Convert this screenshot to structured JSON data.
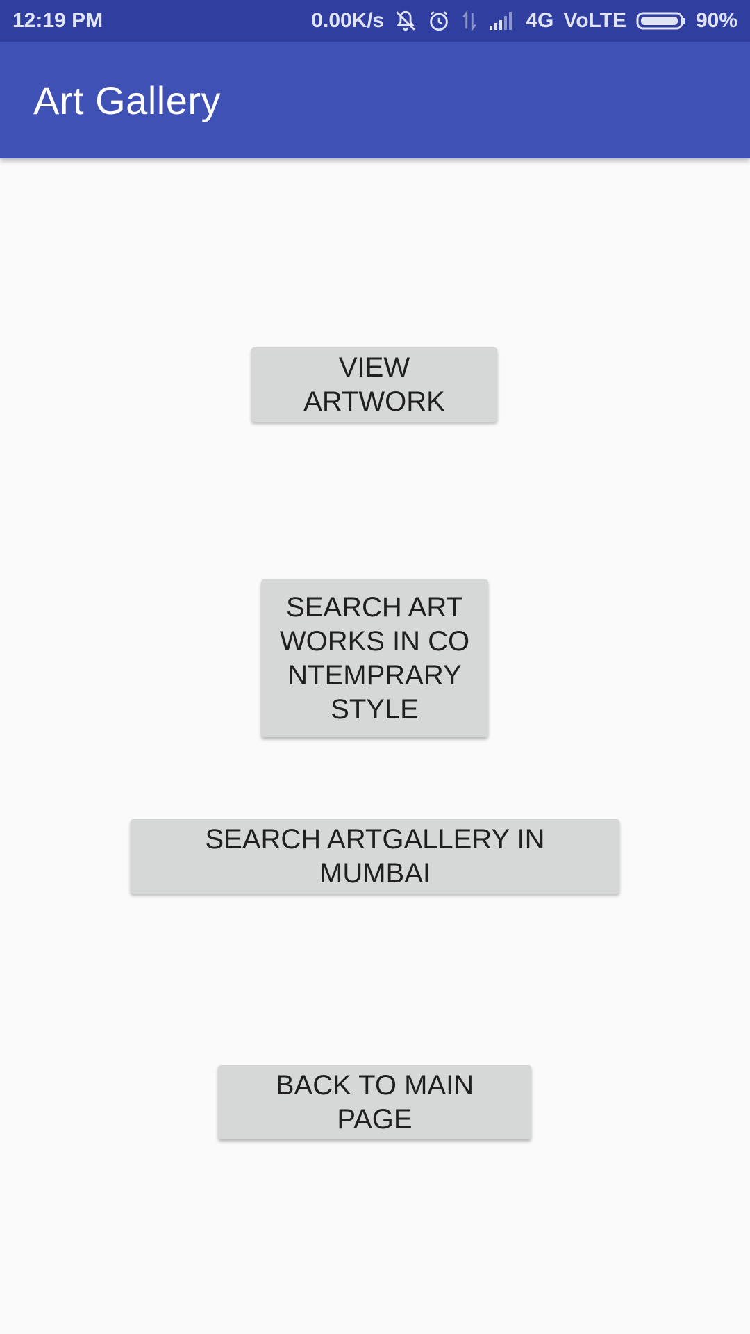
{
  "status_bar": {
    "time": "12:19 PM",
    "network_speed": "0.00K/s",
    "network_type": "4G",
    "volte": "VoLTE",
    "battery": "90%",
    "icons": [
      "muted-bell-icon",
      "alarm-icon",
      "data-arrows-icon",
      "signal-icon",
      "battery-icon"
    ]
  },
  "app_bar": {
    "title": "Art Gallery",
    "color": "#3f51b5"
  },
  "buttons": {
    "view_artwork": "VIEW ARTWORK",
    "search_contemporary": "SEARCH ARTWORKS IN CONTEMPRARY STYLE",
    "search_mumbai": "SEARCH ARTGALLERY IN MUMBAI",
    "back_main": "BACK TO MAIN PAGE"
  }
}
